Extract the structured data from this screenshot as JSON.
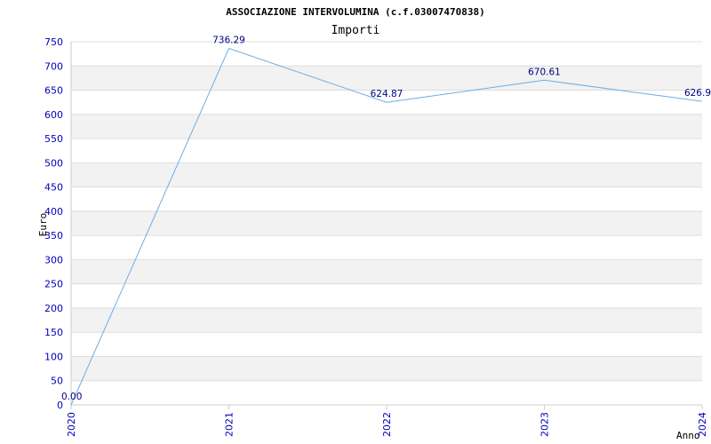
{
  "chart_data": {
    "type": "line",
    "title": "ASSOCIAZIONE INTERVOLUMINA (c.f.03007470838)",
    "subtitle": "Importi",
    "xlabel": "Anno",
    "ylabel": "Euro",
    "categories": [
      "2020",
      "2021",
      "2022",
      "2023",
      "2024"
    ],
    "series": [
      {
        "values": [
          0.0,
          736.29,
          624.87,
          670.61,
          626.9
        ]
      }
    ],
    "data_labels": [
      "0.00",
      "736.29",
      "624.87",
      "670.61",
      "626.9"
    ],
    "ylim": [
      0,
      750
    ],
    "yticks": [
      0,
      50,
      100,
      150,
      200,
      250,
      300,
      350,
      400,
      450,
      500,
      550,
      600,
      650,
      700,
      750
    ],
    "grid": true,
    "colors": {
      "line": "#6aaee8",
      "tick_label": "#0000bb",
      "data_label": "#000080",
      "band": "#f2f2f2",
      "grid": "#dddddd",
      "text": "#000000"
    }
  }
}
